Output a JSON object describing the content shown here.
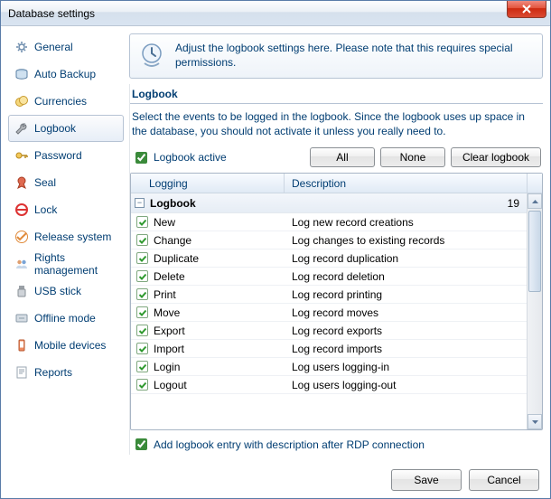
{
  "window": {
    "title": "Database settings"
  },
  "sidebar": {
    "items": [
      {
        "label": "General",
        "icon": "gear"
      },
      {
        "label": "Auto Backup",
        "icon": "disk"
      },
      {
        "label": "Currencies",
        "icon": "coins"
      },
      {
        "label": "Logbook",
        "icon": "wrench"
      },
      {
        "label": "Password",
        "icon": "key"
      },
      {
        "label": "Seal",
        "icon": "ribbon"
      },
      {
        "label": "Lock",
        "icon": "nosign"
      },
      {
        "label": "Release system",
        "icon": "release"
      },
      {
        "label": "Rights management",
        "icon": "users"
      },
      {
        "label": "USB stick",
        "icon": "usb"
      },
      {
        "label": "Offline mode",
        "icon": "offline"
      },
      {
        "label": "Mobile devices",
        "icon": "mobile"
      },
      {
        "label": "Reports",
        "icon": "report"
      }
    ],
    "selected_index": 3
  },
  "banner": {
    "text": "Adjust the logbook settings here. Please note that this requires special permissions."
  },
  "section": {
    "title": "Logbook",
    "description": "Select the events to be logged in the logbook. Since the logbook uses up space in the database, you should not activate it unless you really need to."
  },
  "controls": {
    "active_label": "Logbook active",
    "active_checked": true,
    "btn_all": "All",
    "btn_none": "None",
    "btn_clear": "Clear logbook"
  },
  "table": {
    "col1": "Logging",
    "col2": "Description",
    "group_name": "Logbook",
    "group_count": "19",
    "rows": [
      {
        "name": "New",
        "desc": "Log new record creations",
        "checked": true
      },
      {
        "name": "Change",
        "desc": "Log changes to existing records",
        "checked": true
      },
      {
        "name": "Duplicate",
        "desc": "Log record duplication",
        "checked": true
      },
      {
        "name": "Delete",
        "desc": "Log record deletion",
        "checked": true
      },
      {
        "name": "Print",
        "desc": "Log record printing",
        "checked": true
      },
      {
        "name": "Move",
        "desc": "Log record moves",
        "checked": true
      },
      {
        "name": "Export",
        "desc": "Log record exports",
        "checked": true
      },
      {
        "name": "Import",
        "desc": "Log record imports",
        "checked": true
      },
      {
        "name": "Login",
        "desc": "Log users logging-in",
        "checked": true
      },
      {
        "name": "Logout",
        "desc": "Log users logging-out",
        "checked": true
      }
    ]
  },
  "rdp": {
    "label": "Add logbook entry with description after RDP connection",
    "checked": true
  },
  "buttons": {
    "save": "Save",
    "cancel": "Cancel"
  }
}
